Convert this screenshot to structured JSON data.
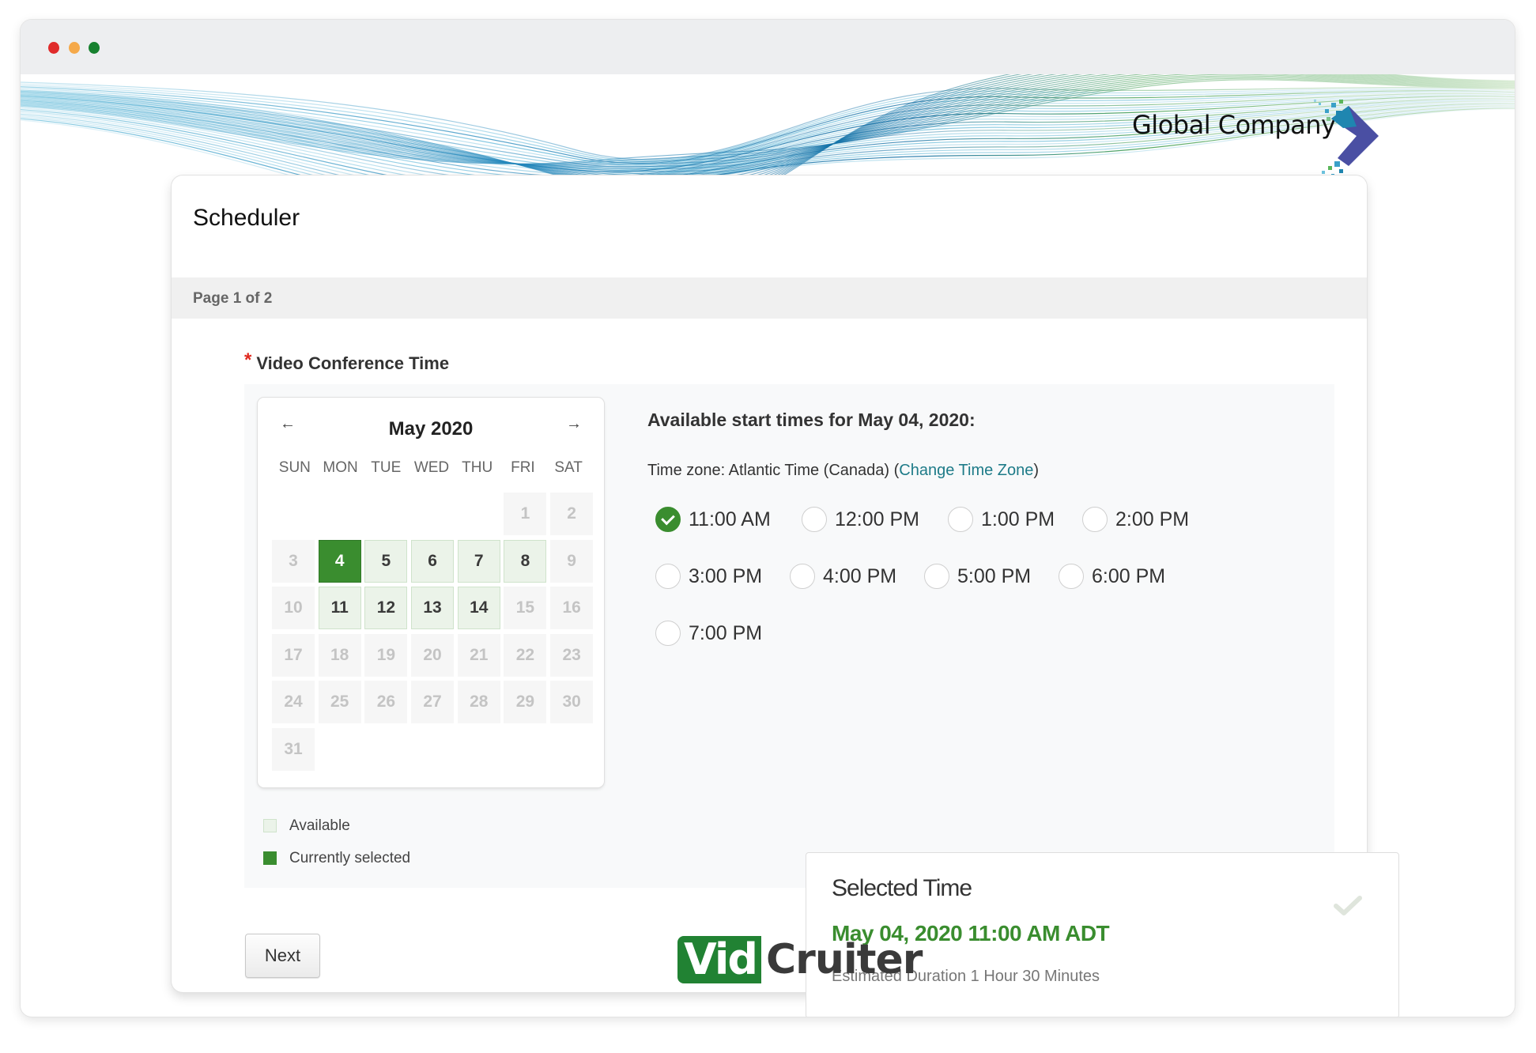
{
  "window": {
    "controls": [
      "close",
      "minimize",
      "maximize"
    ]
  },
  "brand": {
    "company_name": "Global Company",
    "icon": "chevron-pixel-logo-icon"
  },
  "scheduler": {
    "title": "Scheduler",
    "page_indicator": "Page 1 of 2",
    "field_label": "Video Conference Time",
    "required_marker": "*"
  },
  "calendar": {
    "month_label": "May 2020",
    "prev_icon": "←",
    "next_icon": "→",
    "weekdays": [
      "SUN",
      "MON",
      "TUE",
      "WED",
      "THU",
      "FRI",
      "SAT"
    ],
    "days": [
      {
        "label": "",
        "state": "empty"
      },
      {
        "label": "",
        "state": "empty"
      },
      {
        "label": "",
        "state": "empty"
      },
      {
        "label": "",
        "state": "empty"
      },
      {
        "label": "",
        "state": "empty"
      },
      {
        "label": "1",
        "state": "disabled"
      },
      {
        "label": "2",
        "state": "disabled"
      },
      {
        "label": "3",
        "state": "disabled"
      },
      {
        "label": "4",
        "state": "selected"
      },
      {
        "label": "5",
        "state": "available"
      },
      {
        "label": "6",
        "state": "available"
      },
      {
        "label": "7",
        "state": "available"
      },
      {
        "label": "8",
        "state": "available"
      },
      {
        "label": "9",
        "state": "disabled"
      },
      {
        "label": "10",
        "state": "disabled"
      },
      {
        "label": "11",
        "state": "available"
      },
      {
        "label": "12",
        "state": "available"
      },
      {
        "label": "13",
        "state": "available"
      },
      {
        "label": "14",
        "state": "available"
      },
      {
        "label": "15",
        "state": "disabled"
      },
      {
        "label": "16",
        "state": "disabled"
      },
      {
        "label": "17",
        "state": "disabled"
      },
      {
        "label": "18",
        "state": "disabled"
      },
      {
        "label": "19",
        "state": "disabled"
      },
      {
        "label": "20",
        "state": "disabled"
      },
      {
        "label": "21",
        "state": "disabled"
      },
      {
        "label": "22",
        "state": "disabled"
      },
      {
        "label": "23",
        "state": "disabled"
      },
      {
        "label": "24",
        "state": "disabled"
      },
      {
        "label": "25",
        "state": "disabled"
      },
      {
        "label": "26",
        "state": "disabled"
      },
      {
        "label": "27",
        "state": "disabled"
      },
      {
        "label": "28",
        "state": "disabled"
      },
      {
        "label": "29",
        "state": "disabled"
      },
      {
        "label": "30",
        "state": "disabled"
      },
      {
        "label": "31",
        "state": "disabled"
      }
    ],
    "legend": {
      "available": "Available",
      "selected": "Currently selected"
    }
  },
  "times": {
    "heading": "Available start times for May 04, 2020:",
    "timezone_prefix": "Time zone: Atlantic Time (Canada) (",
    "timezone_link": "Change Time Zone",
    "timezone_suffix": ")",
    "options": [
      {
        "label": "11:00 AM",
        "checked": true
      },
      {
        "label": "12:00 PM",
        "checked": false
      },
      {
        "label": "1:00 PM",
        "checked": false
      },
      {
        "label": "2:00 PM",
        "checked": false
      },
      {
        "label": "3:00 PM",
        "checked": false
      },
      {
        "label": "4:00 PM",
        "checked": false
      },
      {
        "label": "5:00 PM",
        "checked": false
      },
      {
        "label": "6:00 PM",
        "checked": false
      },
      {
        "label": "7:00 PM",
        "checked": false
      }
    ]
  },
  "selected_time": {
    "title": "Selected Time",
    "value": "May 04, 2020 11:00 AM ADT",
    "duration": "Estimated Duration 1 Hour 30 Minutes"
  },
  "footer": {
    "next_label": "Next",
    "logo_vid": "Vid",
    "logo_cruiter": "Cruiter"
  },
  "colors": {
    "accent_green": "#3a8d2f",
    "link_teal": "#1e7b88",
    "required_red": "#e0281e",
    "logo_green": "#218233",
    "logo_purple": "#4a4fa3"
  }
}
